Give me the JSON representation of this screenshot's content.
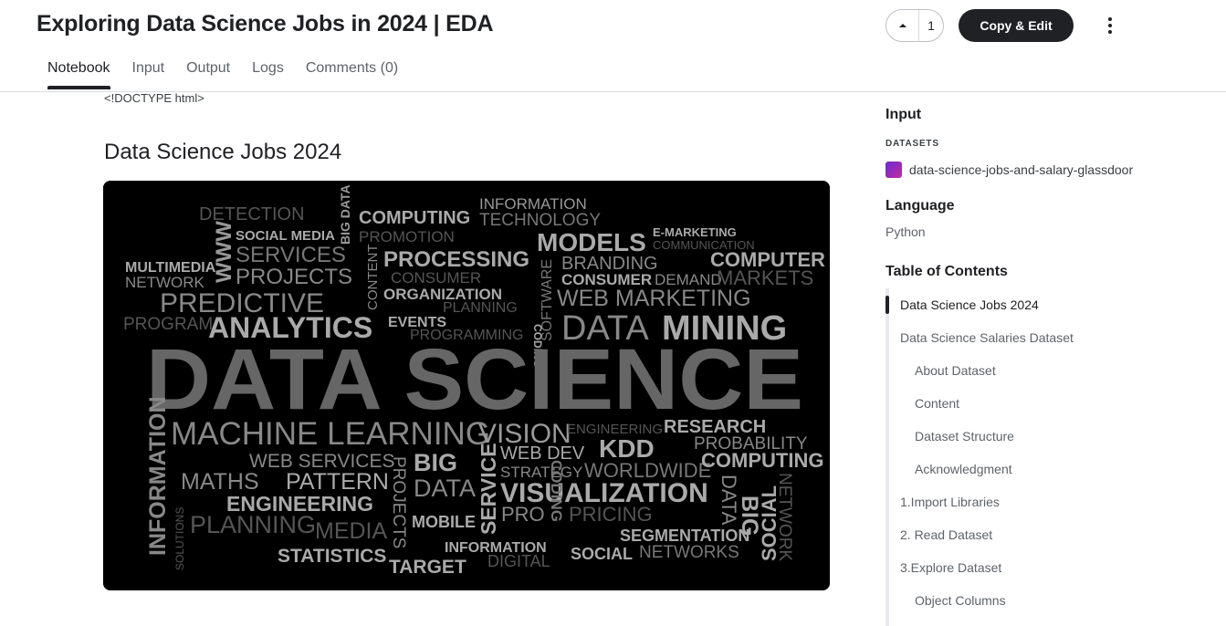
{
  "header": {
    "title": "Exploring Data Science Jobs in 2024 | EDA",
    "vote_count": "1",
    "copy_edit_label": "Copy & Edit"
  },
  "tabs": [
    {
      "label": "Notebook"
    },
    {
      "label": "Input"
    },
    {
      "label": "Output"
    },
    {
      "label": "Logs"
    },
    {
      "label": "Comments (0)"
    }
  ],
  "notebook": {
    "doctype_text": "<!DOCTYPE html>",
    "heading": "Data Science Jobs 2024",
    "word_cloud": [
      "DETECTION",
      "SOCIAL MEDIA",
      "BIG DATA",
      "COMPUTING",
      "PROMOTION",
      "INFORMATION",
      "TECHNOLOGY",
      "E-MARKETING",
      "COMMUNICATION",
      "MULTIMEDIA",
      "NETWORK",
      "WWW",
      "SERVICES",
      "PROJECTS",
      "PROCESSING",
      "CONSUMER",
      "MODELS",
      "BRANDING",
      "CONSUMER",
      "DEMAND",
      "COMPUTER",
      "MARKETS",
      "CONTENT",
      "ORGANIZATION",
      "PLANNING",
      "CODING",
      "SOFTWARE",
      "WEB MARKETING",
      "PREDICTIVE",
      "PROGRAM",
      "ANALYTICS",
      "EVENTS",
      "PROGRAMMING",
      "DATA",
      "MINING",
      "DATA SCIENCE",
      "MACHINE LEARNING",
      "VISION",
      "ENGINEERING",
      "RESEARCH",
      "PROBABILITY",
      "INFORMATION",
      "WEB SERVICES",
      "PROJECTS",
      "BIG",
      "DATA",
      "SERVICE",
      "WEB DEV",
      "KDD",
      "STRATEGY",
      "WORLDWIDE",
      "COMPUTING",
      "MATHS",
      "PATTERN",
      "ENGINEERING",
      "VISUALIZATION",
      "BIG",
      "DATA",
      "SOLUTIONS",
      "PLANNING",
      "MEDIA",
      "MOBILE",
      "PRO",
      "PRICING",
      "SOCIAL",
      "NETWORK",
      "SEGMENTATION",
      "STATISTICS",
      "INFORMATION",
      "DIGITAL",
      "CODING",
      "SOCIAL",
      "NETWORKS",
      "TARGET"
    ]
  },
  "sidebar": {
    "input_heading": "Input",
    "datasets_label": "DATASETS",
    "dataset_name": "data-science-jobs-and-salary-glassdoor",
    "language_heading": "Language",
    "language_value": "Python",
    "toc_heading": "Table of Contents",
    "toc": [
      {
        "label": "Data Science Jobs 2024",
        "level": 1
      },
      {
        "label": "Data Science Salaries Dataset",
        "level": 1
      },
      {
        "label": "About Dataset",
        "level": 2
      },
      {
        "label": "Content",
        "level": 2
      },
      {
        "label": "Dataset Structure",
        "level": 2
      },
      {
        "label": "Acknowledgment",
        "level": 2
      },
      {
        "label": "1.Import Libraries",
        "level": 1
      },
      {
        "label": "2. Read Dataset",
        "level": 1
      },
      {
        "label": "3.Explore Dataset",
        "level": 1
      },
      {
        "label": "Object Columns",
        "level": 2
      }
    ]
  }
}
